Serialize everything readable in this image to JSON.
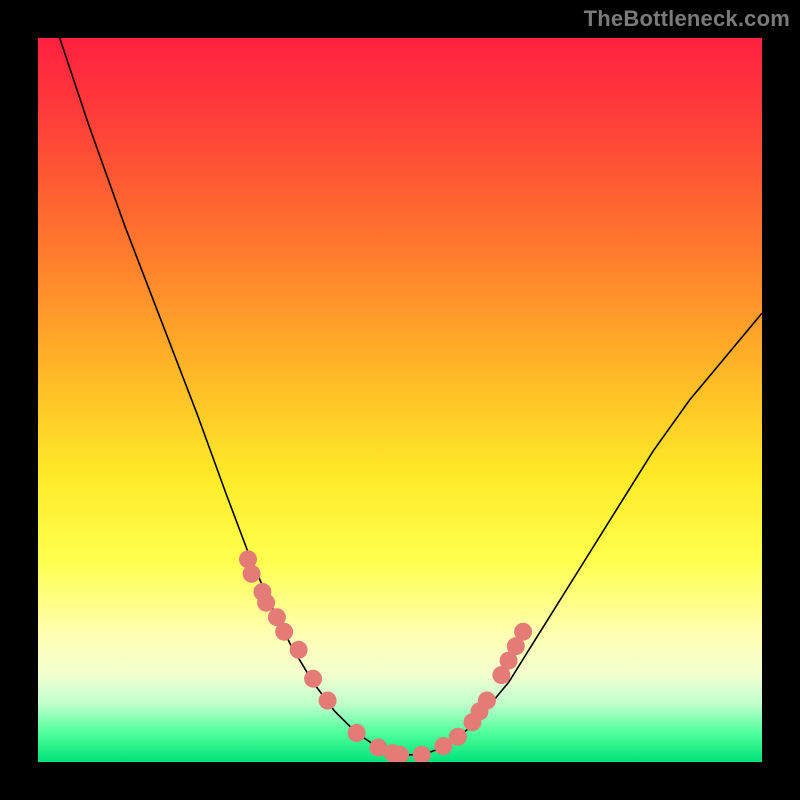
{
  "watermark": "TheBottleneck.com",
  "chart_data": {
    "type": "line",
    "title": "",
    "xlabel": "",
    "ylabel": "",
    "xlim": [
      0,
      100
    ],
    "ylim": [
      0,
      100
    ],
    "grid": false,
    "legend": false,
    "series": [
      {
        "name": "bottleneck-curve",
        "x": [
          3,
          7,
          12,
          17,
          22,
          26,
          29,
          32,
          35,
          38,
          41,
          44,
          47,
          50,
          53,
          56,
          60,
          65,
          70,
          75,
          80,
          85,
          90,
          95,
          100
        ],
        "y": [
          100,
          88,
          74,
          61,
          48,
          37,
          29,
          22,
          16,
          11,
          7,
          4,
          2,
          1,
          1,
          2,
          5,
          11,
          19,
          27,
          35,
          43,
          50,
          56,
          62
        ]
      }
    ],
    "markers": {
      "name": "highlight-dots",
      "x": [
        29,
        29.5,
        31,
        31.5,
        33,
        34,
        36,
        38,
        40,
        44,
        47,
        49,
        50,
        53,
        56,
        58,
        60,
        61,
        62,
        64,
        65,
        66,
        67
      ],
      "y": [
        28,
        26,
        23.5,
        22,
        20,
        18,
        15.5,
        11.5,
        8.5,
        4,
        2,
        1.2,
        1,
        1,
        2.2,
        3.5,
        5.5,
        7,
        8.5,
        12,
        14,
        16,
        18
      ]
    },
    "background_gradient": [
      {
        "stop": 0,
        "color": "#ff2040"
      },
      {
        "stop": 100,
        "color": "#00e37a"
      }
    ]
  }
}
